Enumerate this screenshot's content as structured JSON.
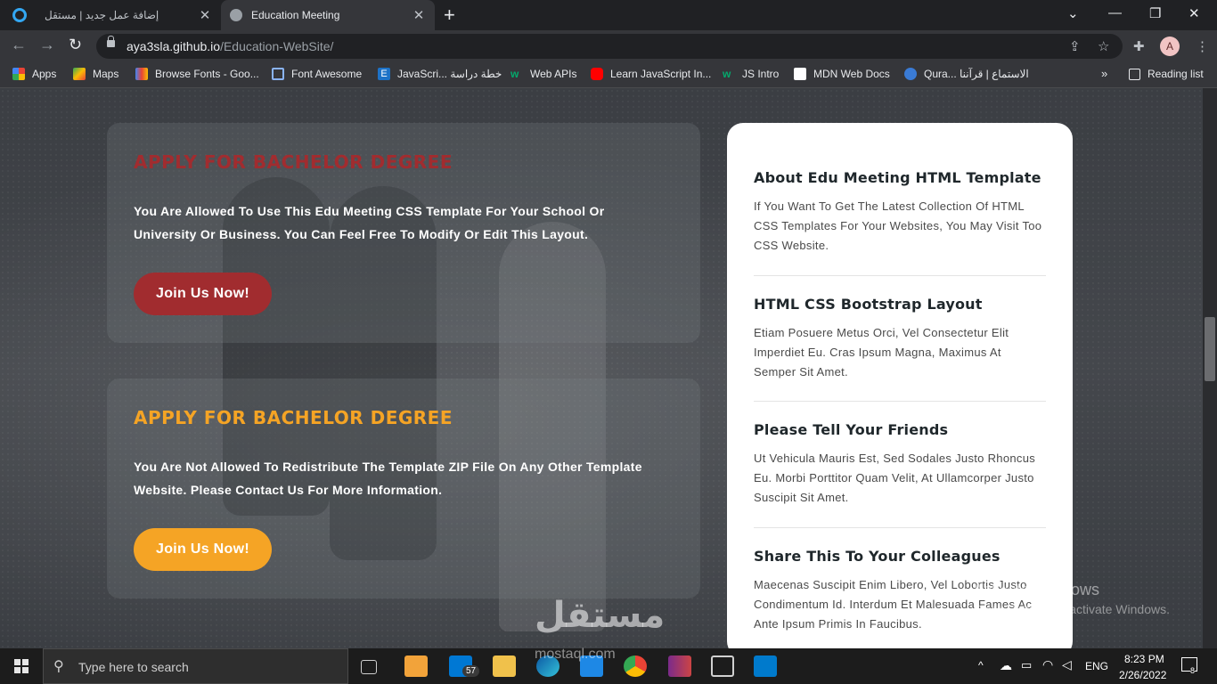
{
  "browser": {
    "tabs": [
      {
        "title": "إضافة عمل جديد | مستقل",
        "active": false
      },
      {
        "title": "Education Meeting",
        "active": true
      }
    ],
    "url_host": "aya3sla.github.io",
    "url_path": "/Education-WebSite/",
    "profile_initial": "A",
    "bookmarks": [
      {
        "label": "Apps",
        "icon": "apps-grid-icon"
      },
      {
        "label": "Maps",
        "icon": "maps-icon"
      },
      {
        "label": "Browse Fonts - Goo...",
        "icon": "google-fonts-icon"
      },
      {
        "label": "Font Awesome",
        "icon": "font-awesome-flag-icon"
      },
      {
        "label": "JavaScri... خطة دراسة",
        "icon": "e-icon"
      },
      {
        "label": "Web APIs",
        "icon": "w3-icon"
      },
      {
        "label": "Learn JavaScript In...",
        "icon": "youtube-icon"
      },
      {
        "label": "JS Intro",
        "icon": "w3-icon"
      },
      {
        "label": "MDN Web Docs",
        "icon": "mdn-icon"
      },
      {
        "label": "Qura... الاستماع | قرآننا",
        "icon": "quran-icon"
      }
    ],
    "reading_list": "Reading list"
  },
  "cards": [
    {
      "title": "APPLY FOR BACHELOR DEGREE",
      "title_color": "#a12c2f",
      "text": "You Are Allowed To Use This Edu Meeting CSS Template For Your School Or University Or Business. You Can Feel Free To Modify Or Edit This Layout.",
      "button": "Join Us Now!",
      "button_color": "#a12c2f"
    },
    {
      "title": "APPLY FOR BACHELOR DEGREE",
      "title_color": "#f5a425",
      "text": "You Are Not Allowed To Redistribute The Template ZIP File On Any Other Template Website. Please Contact Us For More Information.",
      "button": "Join Us Now!",
      "button_color": "#f5a425"
    }
  ],
  "sidebar": [
    {
      "title": "About Edu Meeting HTML Template",
      "text": "If You Want To Get The Latest Collection Of HTML CSS Templates For Your Websites, You May Visit Too CSS Website."
    },
    {
      "title": "HTML CSS Bootstrap Layout",
      "text": "Etiam Posuere Metus Orci, Vel Consectetur Elit Imperdiet Eu. Cras Ipsum Magna, Maximus At Semper Sit Amet."
    },
    {
      "title": "Please Tell Your Friends",
      "text": "Ut Vehicula Mauris Est, Sed Sodales Justo Rhoncus Eu. Morbi Porttitor Quam Velit, At Ullamcorper Justo Suscipit Sit Amet."
    },
    {
      "title": "Share This To Your Colleagues",
      "text": "Maecenas Suscipit Enim Libero, Vel Lobortis Justo Condimentum Id. Interdum Et Malesuada Fames Ac Ante Ipsum Primis In Faucibus."
    }
  ],
  "watermark": {
    "activate_title": "Activate Windows",
    "activate_sub": "Go to Settings to activate Windows.",
    "mostaql_ar": "مستقل",
    "mostaql_en": "mostaql.com"
  },
  "taskbar": {
    "search_placeholder": "Type here to search",
    "mail_badge": "57",
    "language": "ENG",
    "time": "8:23 PM",
    "date": "2/26/2022",
    "notification_count": "8"
  }
}
